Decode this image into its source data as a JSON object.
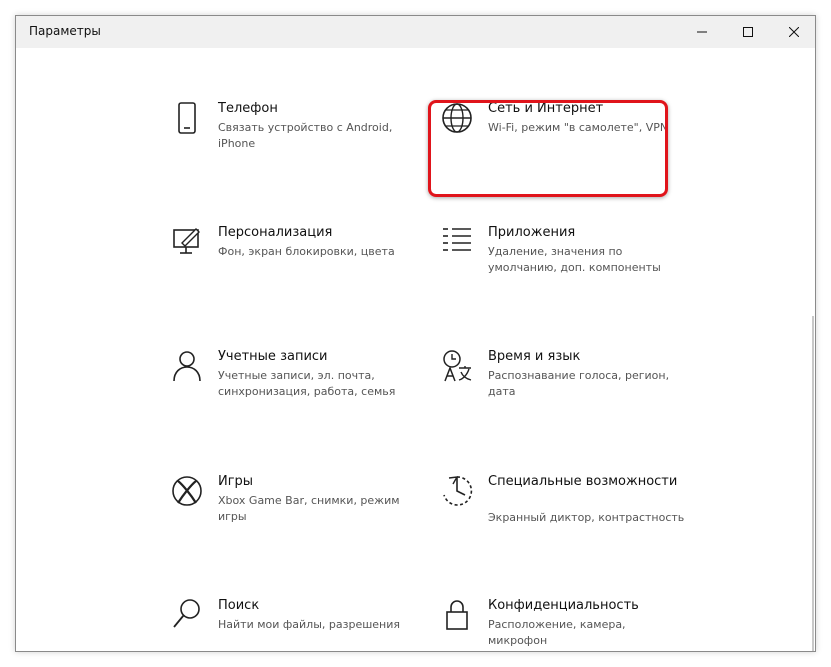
{
  "window": {
    "title": "Параметры"
  },
  "tiles": [
    {
      "name": "Телефон",
      "desc": "Связать устройство с Android, iPhone",
      "icon": "phone-icon"
    },
    {
      "name": "Сеть и Интернет",
      "desc": "Wi-Fi, режим \"в самолете\", VPN",
      "icon": "globe-icon"
    },
    {
      "name": "Персонализация",
      "desc": "Фон, экран блокировки, цвета",
      "icon": "personalization-icon"
    },
    {
      "name": "Приложения",
      "desc": "Удаление, значения по умолчанию, доп. компоненты",
      "icon": "apps-list-icon"
    },
    {
      "name": "Учетные записи",
      "desc": "Учетные записи, эл. почта, синхронизация, работа, семья",
      "icon": "person-icon"
    },
    {
      "name": "Время и язык",
      "desc": "Распознавание голоса, регион, дата",
      "icon": "time-language-icon"
    },
    {
      "name": "Игры",
      "desc": "Xbox Game Bar, снимки, режим игры",
      "icon": "xbox-icon"
    },
    {
      "name": "Специальные возможности",
      "desc": "Экранный диктор, контрастность",
      "icon": "accessibility-icon"
    },
    {
      "name": "Поиск",
      "desc": "Найти мои файлы, разрешения",
      "icon": "search-icon"
    },
    {
      "name": "Конфиденциальность",
      "desc": "Расположение, камера, микрофон",
      "icon": "lock-icon"
    }
  ],
  "colors": {
    "highlight": "#e0141b",
    "titlebar": "#f0f0f0"
  }
}
